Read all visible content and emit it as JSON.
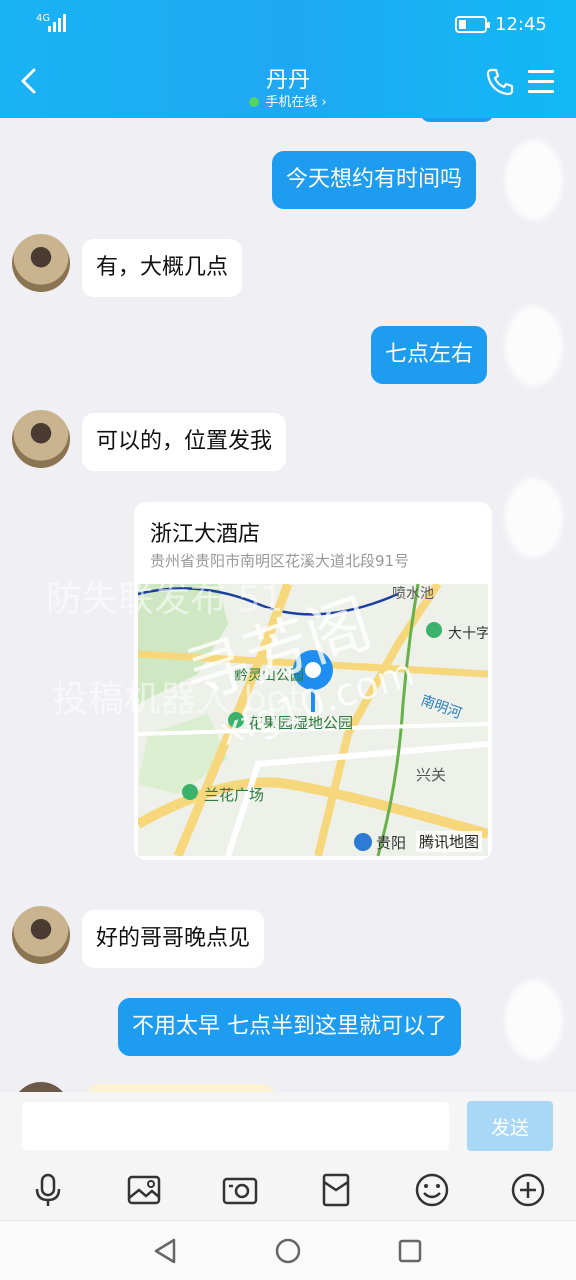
{
  "status_bar": {
    "network": "4G",
    "time": "12:45",
    "battery_level": 0.2
  },
  "header": {
    "back_icon": "chevron-left-icon",
    "title": "丹丹",
    "status": "手机在线",
    "status_arrow": "›",
    "call_icon": "phone-icon",
    "menu_icon": "menu-icon"
  },
  "messages": [
    {
      "dir": "out",
      "text": "今天想约有时间吗"
    },
    {
      "dir": "in",
      "text": "有，大概几点"
    },
    {
      "dir": "out",
      "text": "七点左右"
    },
    {
      "dir": "in",
      "text": "可以的，位置发我"
    },
    {
      "dir": "out",
      "type": "location",
      "name": "浙江大酒店",
      "address": "贵州省贵阳市南明区花溪大道北段91号"
    },
    {
      "dir": "in",
      "text": "好的哥哥晚点见"
    },
    {
      "dir": "out",
      "text": "不用太早 七点半到这里就可以了"
    }
  ],
  "map": {
    "labels": {
      "park1": "花果园湿地公园",
      "park2": "兰花广场",
      "river": "南明河",
      "district": "兴关",
      "area1": "大十字",
      "area2": "贵阳",
      "area3": "黔灵山公园",
      "area4": "喷水池"
    },
    "provider": "腾讯地图",
    "colors": {
      "road_major": "#f6d77b",
      "road_minor": "#ffffff",
      "green": "#cfe8c3",
      "river_line": "#67b14a",
      "rail": "#1b3fa0",
      "pin": "#1e8ef0"
    }
  },
  "watermark": {
    "line1": "防失联发布 51",
    "line2": "投稿机器人 bot",
    "logo_cn": "寻芳阁",
    "logo_url": "xfg10.com"
  },
  "input": {
    "placeholder": "",
    "send_label": "发送"
  },
  "toolbar": [
    "mic-icon",
    "image-icon",
    "camera-icon",
    "red-packet-icon",
    "emoji-icon",
    "plus-icon"
  ],
  "nav": [
    "back-triangle-icon",
    "home-circle-icon",
    "recents-square-icon"
  ]
}
